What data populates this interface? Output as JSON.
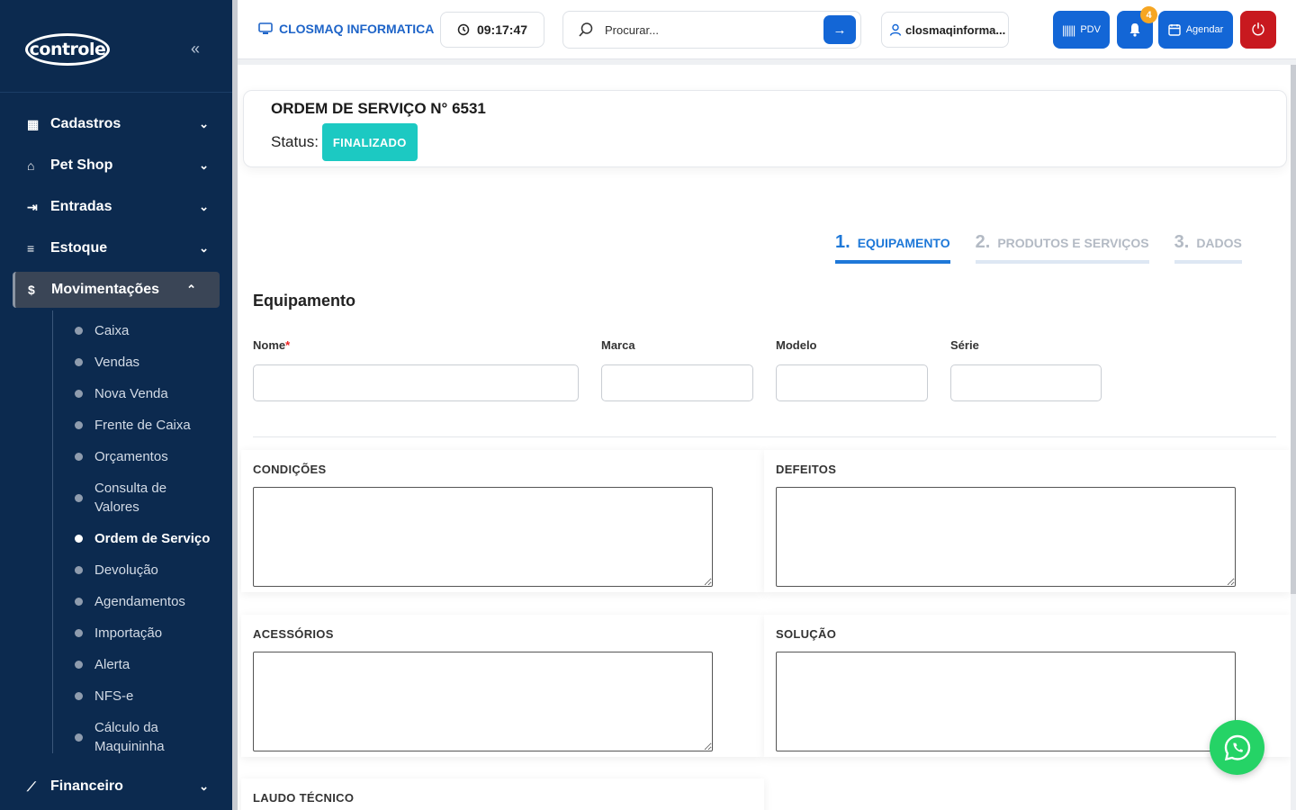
{
  "sidebar": {
    "logo_text": "controle",
    "items": [
      {
        "label": "Cadastros",
        "icon": "grid-icon"
      },
      {
        "label": "Pet Shop",
        "icon": "store-icon"
      },
      {
        "label": "Entradas",
        "icon": "login-icon"
      },
      {
        "label": "Estoque",
        "icon": "list-icon"
      },
      {
        "label": "Movimentações",
        "icon": "dollar-icon"
      },
      {
        "label": "Financeiro",
        "icon": "chart-icon"
      }
    ],
    "submenu": [
      "Caixa",
      "Vendas",
      "Nova Venda",
      "Frente de Caixa",
      "Orçamentos",
      "Consulta de Valores",
      "Ordem de Serviço",
      "Devolução",
      "Agendamentos",
      "Importação",
      "Alerta",
      "NFS-e",
      "Cálculo da Maquininha"
    ],
    "active_submenu": "Ordem de Serviço"
  },
  "topbar": {
    "company": "CLOSMAQ INFORMATICA",
    "time": "09:17:47",
    "search_placeholder": "Procurar...",
    "user": "closmaqinforma...",
    "pdv_label": "PDV",
    "notification_count": "4",
    "agendar_label": "Agendar"
  },
  "order": {
    "title": "ORDEM DE SERVIÇO N° 6531",
    "status_label": "Status:",
    "status": "FINALIZADO"
  },
  "steps": [
    {
      "num": "1.",
      "label": "EQUIPAMENTO",
      "active": true
    },
    {
      "num": "2.",
      "label": "PRODUTOS E SERVIÇOS",
      "active": false
    },
    {
      "num": "3.",
      "label": "DADOS",
      "active": false
    }
  ],
  "form": {
    "section_title": "Equipamento",
    "nome_label": "Nome",
    "required_mark": "*",
    "marca_label": "Marca",
    "modelo_label": "Modelo",
    "serie_label": "Série",
    "condicoes_label": "CONDIÇÕES",
    "defeitos_label": "DEFEITOS",
    "acessorios_label": "ACESSÓRIOS",
    "solucao_label": "SOLUÇÃO",
    "laudo_label": "LAUDO TÉCNICO"
  },
  "colors": {
    "sidebar_bg": "#0c2a4f",
    "primary": "#1366d6",
    "status": "#1cc9c2",
    "danger": "#c8191f",
    "whatsapp": "#25d366"
  }
}
